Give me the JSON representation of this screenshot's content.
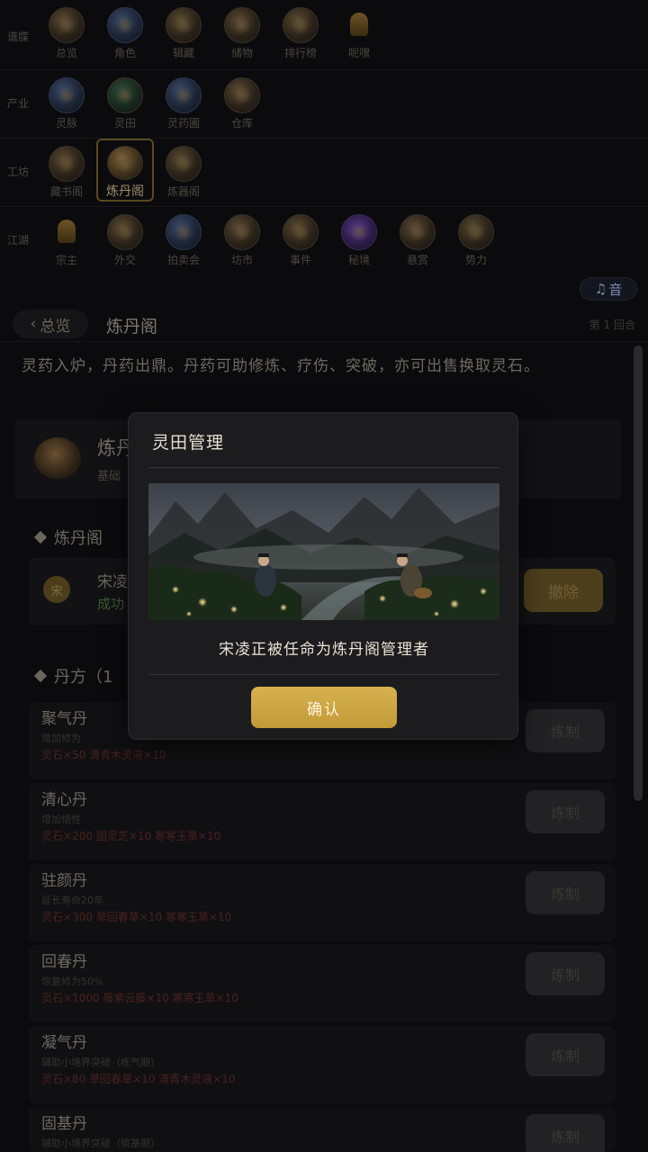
{
  "nav_rows": [
    {
      "label": "",
      "items": [
        {
          "label": "总览",
          "icon": "overview-icon"
        },
        {
          "label": "角色",
          "icon": "character-icon"
        },
        {
          "label": "辑藏",
          "icon": "collection-icon"
        },
        {
          "label": "储物",
          "icon": "storage-icon"
        },
        {
          "label": "排行榜",
          "icon": "leaderboard-icon"
        },
        {
          "label": "呢嘿",
          "icon": "bell-icon"
        }
      ]
    },
    {
      "label": "",
      "items": [
        {
          "label": "灵脉",
          "icon": "spirit-vein-icon"
        },
        {
          "label": "灵田",
          "icon": "spirit-field-icon"
        },
        {
          "label": "灵药圃",
          "icon": "herb-garden-icon"
        },
        {
          "label": "仓库",
          "icon": "warehouse-icon"
        }
      ]
    },
    {
      "label": "",
      "items": [
        {
          "label": "藏书阁",
          "icon": "library-icon"
        },
        {
          "label": "炼丹阁",
          "icon": "alchemy-icon",
          "active": true
        },
        {
          "label": "炼器阁",
          "icon": "forge-icon"
        }
      ]
    },
    {
      "label": "江湖",
      "items": [
        {
          "label": "宗主",
          "icon": "sect-master-icon"
        },
        {
          "label": "外交",
          "icon": "diplomacy-icon"
        },
        {
          "label": "拍卖会",
          "icon": "auction-icon"
        },
        {
          "label": "坊市",
          "icon": "market-icon"
        },
        {
          "label": "事件",
          "icon": "event-icon"
        },
        {
          "label": "秘境",
          "icon": "secret-realm-icon"
        },
        {
          "label": "悬赏",
          "icon": "bounty-icon"
        },
        {
          "label": "势力",
          "icon": "faction-icon"
        }
      ]
    }
  ],
  "music_badge": {
    "icon": "♫",
    "label": "音"
  },
  "header": {
    "back_label": "总览",
    "title": "炼丹阁",
    "turn_info": "第 1 回合"
  },
  "intro": "灵药入炉，丹药出鼎。丹药可助修炼、疗伤、突破，亦可出售换取灵石。",
  "hall": {
    "name": "炼丹阁",
    "level": "基础"
  },
  "manager_section": {
    "title": "炼丹阁",
    "avatar": "宋",
    "name": "宋凌",
    "status": "成功",
    "dismiss_label": "撤除"
  },
  "recipes_section": {
    "title": "丹方（1"
  },
  "recipes": [
    {
      "name": "聚气丹",
      "desc": "增加修为",
      "cost": "灵石×50  清青木灵液×10",
      "button": "炼制"
    },
    {
      "name": "清心丹",
      "desc": "增加悟性",
      "cost": "灵石×200  固灵芝×10  寒寒玉草×10",
      "button": "炼制"
    },
    {
      "name": "驻颜丹",
      "desc": "延长寿命20年",
      "cost": "灵石×300  草回春草×10  寒寒玉草×10",
      "button": "炼制"
    },
    {
      "name": "回春丹",
      "desc": "恢复修为50%",
      "cost": "灵石×1000  藤紫云藤×10  寒寒玉草×10",
      "button": "炼制"
    },
    {
      "name": "凝气丹",
      "desc": "辅助小境界突破（练气期）",
      "cost": "灵石×80  草回春草×10  清青木灵液×10",
      "button": "炼制"
    },
    {
      "name": "固基丹",
      "desc": "辅助小境界突破（筑基期）",
      "cost": "",
      "button": "炼制"
    }
  ],
  "modal": {
    "title": "灵田管理",
    "message": "宋凌正被任命为炼丹阁管理者",
    "confirm_label": "确认",
    "image_icon": "herb-gathering-illustration"
  }
}
